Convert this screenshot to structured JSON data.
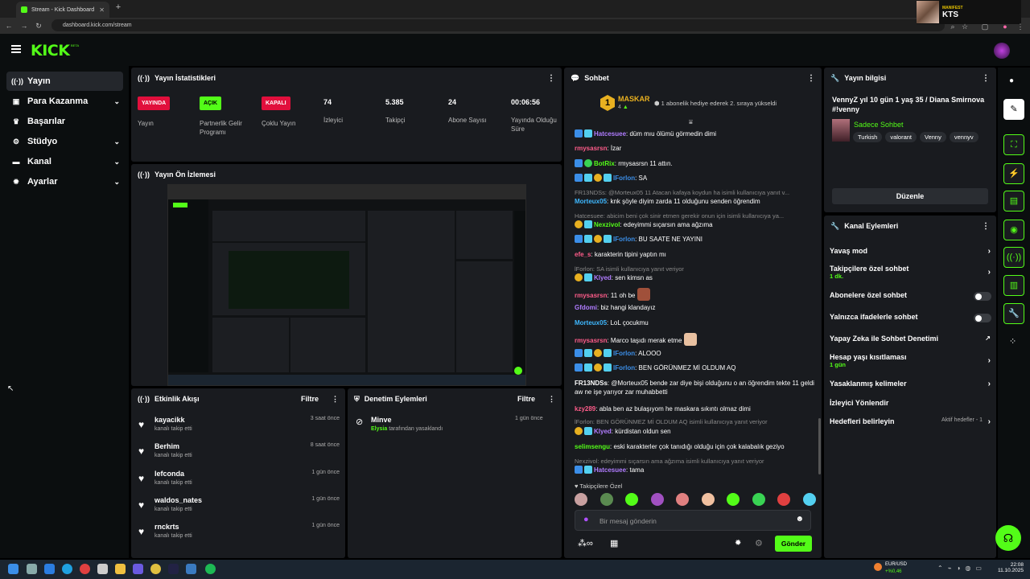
{
  "browser": {
    "tab_title": "Stream - Kick Dashboard",
    "url": "dashboard.kick.com/stream",
    "profile_label": "MANIFEST",
    "profile_name": "KTS"
  },
  "header": {
    "logo": "KICK",
    "beta": "BETA"
  },
  "sidebar": {
    "items": [
      {
        "label": "Yayın",
        "icon": "broadcast-icon",
        "active": true
      },
      {
        "label": "Para Kazanma",
        "icon": "money-icon",
        "chevron": true
      },
      {
        "label": "Başarılar",
        "icon": "trophy-icon"
      },
      {
        "label": "Stüdyo",
        "icon": "studio-icon",
        "chevron": true
      },
      {
        "label": "Kanal",
        "icon": "channel-icon",
        "chevron": true
      },
      {
        "label": "Ayarlar",
        "icon": "gear-icon",
        "chevron": true
      }
    ]
  },
  "stats": {
    "title": "Yayın İstatistikleri",
    "items": [
      {
        "value": "YAYINDA",
        "label": "Yayın",
        "kind": "red"
      },
      {
        "value": "AÇIK",
        "label": "Partnerlik Gelir Programı",
        "kind": "green"
      },
      {
        "value": "KAPALI",
        "label": "Çoklu Yayın",
        "kind": "red"
      },
      {
        "value": "74",
        "label": "İzleyici",
        "kind": "num"
      },
      {
        "value": "5.385",
        "label": "Takipçi",
        "kind": "num"
      },
      {
        "value": "24",
        "label": "Abone Sayısı",
        "kind": "num"
      },
      {
        "value": "00:06:56",
        "label": "Yayında Olduğu Süre",
        "kind": "num"
      }
    ]
  },
  "preview": {
    "title": "Yayın Ön İzlemesi"
  },
  "feed": {
    "title": "Etkinlik Akışı",
    "filter": "Filtre",
    "rows": [
      {
        "name": "kayacikk",
        "sub": "kanalı takip etti",
        "time": "3 saat önce"
      },
      {
        "name": "Berhim",
        "sub": "kanalı takip etti",
        "time": "8 saat önce"
      },
      {
        "name": "lefconda",
        "sub": "kanalı takip etti",
        "time": "1 gün önce"
      },
      {
        "name": "waldos_nates",
        "sub": "kanalı takip etti",
        "time": "1 gün önce"
      },
      {
        "name": "rnckrts",
        "sub": "kanalı takip etti",
        "time": "1 gün önce"
      }
    ]
  },
  "mod": {
    "title": "Denetim Eylemleri",
    "filter": "Filtre",
    "name": "Minve",
    "by": "Elysia",
    "action": "tarafından yasaklandı",
    "time": "1 gün önce"
  },
  "chat": {
    "title": "Sohbet",
    "top_user": "MASKAR",
    "top_count": "4",
    "top_rank": "1",
    "top_msg": "1 abonelik hediye ederek 2. sıraya yükseldi",
    "messages": [
      {
        "user": "Hatcesuee",
        "color": "#b07cff",
        "text": ": düm mıu ölümü görmedin dimi",
        "badges": [
          "b",
          "c"
        ]
      },
      {
        "user": "rmysasrsn",
        "color": "#ff5c8a",
        "text": ": İzar",
        "badges": []
      },
      {
        "user": "BotRix",
        "color": "#53fc18",
        "text": ": rmysasrsn 11 attın.",
        "badges": [
          "b",
          "g"
        ]
      },
      {
        "user": "lForlon",
        "color": "#3b8ee8",
        "text": ": SA",
        "badges": [
          "b",
          "c",
          "y",
          "c"
        ]
      },
      {
        "reply": "FR13NDSs: @Morteux05 11 Atacan kafaya koydun ha isimli kullanıcıya yanıt v..."
      },
      {
        "user": "Morteux05",
        "color": "#3fb8ff",
        "text": ": knk şöyle diyim zarda 11 olduğunu senden öğrendim",
        "badges": []
      },
      {
        "reply": "Hatcesuee: abicim beni çok sinir etmen gerekir onun için isimli kullanıcıya ya..."
      },
      {
        "user": "Nexzivol",
        "color": "#53fc18",
        "text": ": edeyimmi sıçarsın ama ağzıma",
        "badges": [
          "y",
          "c"
        ]
      },
      {
        "user": "lForlon",
        "color": "#3b8ee8",
        "text": ": BU SAATE NE YAYINI",
        "badges": [
          "b",
          "c",
          "y",
          "c"
        ]
      },
      {
        "user": "efe_s",
        "color": "#ff5c8a",
        "text": ": karakterin tipini yaptın mı",
        "badges": []
      },
      {
        "reply": "lForlon: SA isimli kullanıcıya yanıt veriyor"
      },
      {
        "user": "Klyed",
        "color": "#b07cff",
        "text": ": sen kimsn as",
        "badges": [
          "y",
          "c"
        ]
      },
      {
        "user": "rmysasrsn",
        "color": "#ff5c8a",
        "text": ": 11 oh be",
        "badges": [],
        "emote": "#a0503a"
      },
      {
        "user": "Gfdomi",
        "color": "#b07cff",
        "text": ": biz hangi klandayız",
        "badges": []
      },
      {
        "user": "Morteux05",
        "color": "#3fb8ff",
        "text": ": LoL çocukmu",
        "badges": []
      },
      {
        "user": "rmysasrsn",
        "color": "#ff5c8a",
        "text": ": Marco taşıdı merak etme",
        "badges": [],
        "emote": "#e8c0a0"
      },
      {
        "user": "lForlon",
        "color": "#3b8ee8",
        "text": ": ALOOO",
        "badges": [
          "b",
          "c",
          "y",
          "c"
        ]
      },
      {
        "user": "lForlon",
        "color": "#3b8ee8",
        "text": ": BEN GÖRÜNMEZ Mİ OLDUM AQ",
        "badges": [
          "b",
          "c",
          "y",
          "c"
        ]
      },
      {
        "user": "FR13NDSs",
        "color": "#ffffff",
        "text": ": @Morteux05 bende zar diye bişi olduğunu o an öğrendim tekte 11 geldi aw ne işe yarıyor zar muhabbetti",
        "badges": [],
        "two": true
      },
      {
        "user": "kzy289",
        "color": "#ff5c8a",
        "text": ": abla ben az bulaşıyom he maskara sıkıntı olmaz dimi",
        "badges": []
      },
      {
        "reply": "lForlon: BEN GÖRÜNMEZ Mİ OLDUM AQ isimli kullanıcıya yanıt veriyor"
      },
      {
        "user": "Klyed",
        "color": "#b07cff",
        "text": ": kürdistan oldun sen",
        "badges": [
          "y",
          "c"
        ]
      },
      {
        "user": "selimsengu",
        "color": "#53fc18",
        "text": ": eski karakterler çok tanıdığı olduğu için çok kalabalık geziyo",
        "badges": []
      },
      {
        "reply": "Nexzivol: edeyimmi sıçarsın ama ağzıma isimli kullanıcıya yanıt veriyor"
      },
      {
        "user": "Hatcesuee",
        "color": "#b07cff",
        "text": ": tama",
        "badges": [
          "b",
          "c"
        ]
      }
    ],
    "emote_bar_label": "Takipçilere Özel",
    "input_placeholder": "Bir mesaj gönderin",
    "send": "Gönder"
  },
  "info": {
    "title": "Yayın bilgisi",
    "stream_title": "VennyZ yıl 10 gün 1 yaş 35 / Diana Smirnova #!venny",
    "category": "Sadece Sohbet",
    "tags": [
      "Turkish",
      "valorant",
      "Venny",
      "vennyv"
    ],
    "edit": "Düzenle"
  },
  "actions": {
    "title": "Kanal Eylemleri",
    "rows": [
      {
        "label": "Yavaş mod",
        "type": "chev"
      },
      {
        "label": "Takipçilere özel sohbet",
        "sub": "1 dk.",
        "type": "chev"
      },
      {
        "label": "Abonelere özel sohbet",
        "type": "toggle"
      },
      {
        "label": "Yalnızca ifadelerle sohbet",
        "type": "toggle"
      },
      {
        "label": "Yapay Zeka ile Sohbet Denetimi",
        "type": "ext"
      },
      {
        "label": "Hesap yaşı kısıtlaması",
        "sub": "1 gün",
        "type": "chev"
      },
      {
        "label": "Yasaklanmış kelimeler",
        "type": "chev"
      },
      {
        "label": "İzleyici Yönlendir",
        "type": "none"
      },
      {
        "label": "Hedefleri belirleyin",
        "extra": "Aktif hedefler - 1",
        "type": "chev"
      }
    ]
  },
  "taskbar": {
    "ticker": "EUR/USD",
    "ticker_change": "+%0,46",
    "time": "22:08",
    "date": "11.10.2025"
  },
  "colors": {
    "accent": "#53fc18",
    "live": "#e10f3c",
    "panel": "#191b1f",
    "background": "#000000"
  }
}
